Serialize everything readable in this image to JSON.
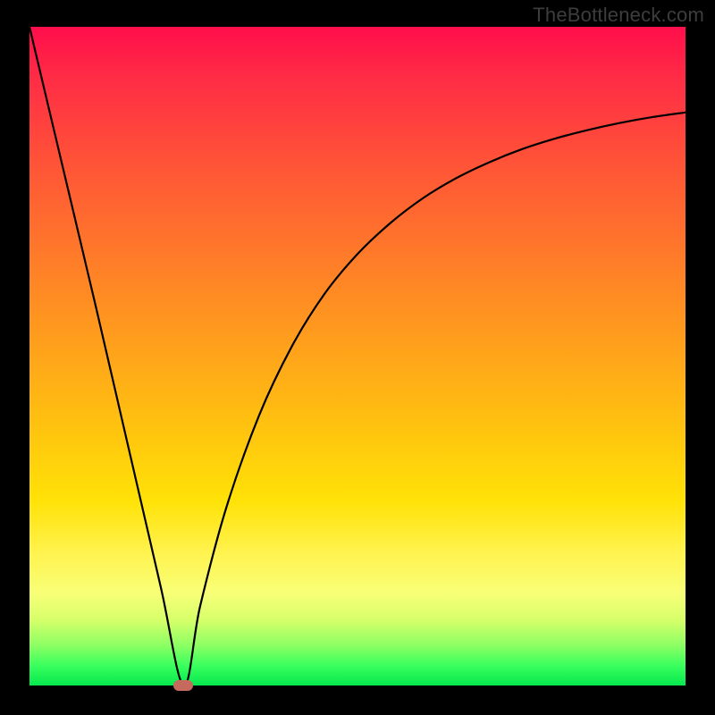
{
  "watermark": "TheBottleneck.com",
  "colors": {
    "frame": "#000000",
    "curve": "#000000",
    "marker": "#c76a5e",
    "gradient_stops": [
      "#ff0e4b",
      "#ff5736",
      "#ffa51a",
      "#ffe207",
      "#f8ff77",
      "#39ff5e",
      "#06e84e"
    ]
  },
  "chart_data": {
    "type": "line",
    "title": "",
    "xlabel": "",
    "ylabel": "",
    "xlim": [
      0,
      100
    ],
    "ylim": [
      0,
      100
    ],
    "grid": false,
    "legend": null,
    "series": [
      {
        "name": "left-branch",
        "x": [
          0,
          5,
          10,
          15,
          20,
          23.5
        ],
        "values": [
          100,
          79,
          58,
          36.5,
          15,
          0
        ]
      },
      {
        "name": "right-branch",
        "x": [
          23.5,
          26,
          30,
          35,
          40,
          45,
          50,
          55,
          60,
          65,
          70,
          75,
          80,
          85,
          90,
          95,
          100
        ],
        "values": [
          0,
          12,
          27,
          41,
          51.5,
          59.5,
          65.5,
          70.2,
          74,
          77,
          79.4,
          81.4,
          83,
          84.3,
          85.4,
          86.3,
          87
        ]
      }
    ],
    "marker": {
      "x": 23.5,
      "y": 0,
      "label": ""
    }
  }
}
